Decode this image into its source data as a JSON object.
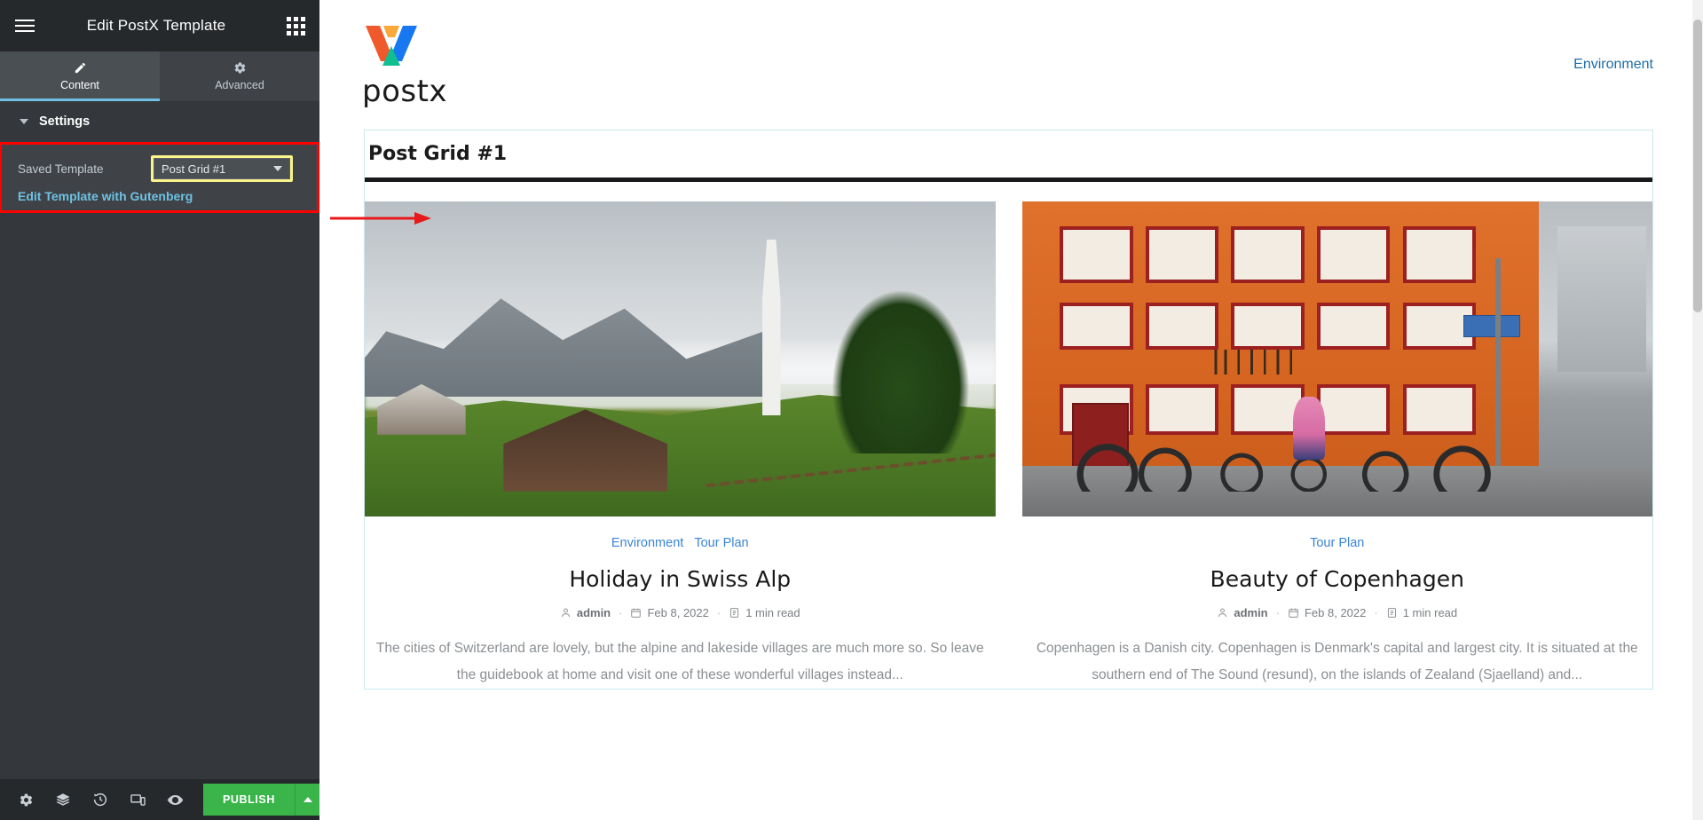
{
  "panel": {
    "title": "Edit PostX Template",
    "hamburger_icon": "hamburger-menu-icon",
    "apps_icon": "apps-grid-icon",
    "tabs": [
      {
        "label": "Content",
        "icon": "pencil-icon",
        "active": true
      },
      {
        "label": "Advanced",
        "icon": "gear-icon",
        "active": false
      }
    ],
    "section": {
      "title": "Settings",
      "collapse_icon": "caret-down-icon",
      "saved_template_label": "Saved Template",
      "saved_template_value": "Post Grid #1",
      "saved_template_caret": "chevron-down-icon",
      "gutenberg_link": "Edit Template with Gutenberg"
    },
    "bottom_bar": {
      "icons": [
        {
          "name": "settings-gear-icon"
        },
        {
          "name": "navigator-layers-icon"
        },
        {
          "name": "history-icon"
        },
        {
          "name": "responsive-mode-icon"
        },
        {
          "name": "preview-eye-icon"
        }
      ],
      "publish_label": "PUBLISH",
      "publish_caret": "caret-up-icon"
    },
    "collapse_handle_icon": "chevron-left-icon"
  },
  "highlights": {
    "box_color": "#ff0000",
    "select_outline_color": "#fbf38c",
    "arrow_color": "#e8191a"
  },
  "preview": {
    "brand": {
      "name": "postx",
      "logo_icon": "postx-logo-icon"
    },
    "nav": [
      {
        "label": "Environment"
      }
    ],
    "block": {
      "title": "Post Grid #1",
      "posts": [
        {
          "thumb_name": "swiss-alp-photo",
          "categories": [
            "Environment",
            "Tour Plan"
          ],
          "title": "Holiday in Swiss Alp",
          "author": "admin",
          "date": "Feb 8, 2022",
          "read_time": "1 min read",
          "excerpt": "The cities of Switzerland are lovely, but the alpine and lakeside villages are much more so. So leave the guidebook at home and visit one of these wonderful villages instead..."
        },
        {
          "thumb_name": "copenhagen-photo",
          "categories": [
            "Tour Plan"
          ],
          "title": "Beauty of Copenhagen",
          "author": "admin",
          "date": "Feb 8, 2022",
          "read_time": "1 min read",
          "excerpt": "Copenhagen is a Danish city. Copenhagen is Denmark's capital and largest city. It is situated at the southern end of The Sound (resund), on the islands of Zealand (Sjaelland) and..."
        }
      ],
      "meta_icons": {
        "author": "person-icon",
        "date": "calendar-icon",
        "read_time": "reading-time-icon"
      },
      "separator": "·"
    }
  },
  "colors": {
    "panel_bg": "#34383c",
    "panel_dark": "#26292c",
    "accent_blue": "#6ec1e4",
    "publish_green": "#39b54a",
    "link_blue": "#3a84d6",
    "nav_blue": "#1b6ca8"
  }
}
